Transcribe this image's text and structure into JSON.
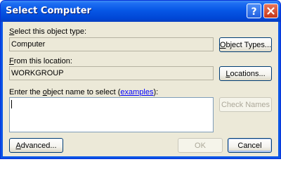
{
  "window": {
    "title": "Select Computer"
  },
  "object_type": {
    "label_prefix": "",
    "label_accel": "S",
    "label_rest": "elect this object type:",
    "value": "Computer",
    "button": {
      "accel": "O",
      "rest": "bject Types..."
    }
  },
  "location": {
    "label_accel": "F",
    "label_rest": "rom this location:",
    "value": "WORKGROUP",
    "button": {
      "accel": "L",
      "rest": "ocations..."
    }
  },
  "object_name": {
    "label_before": "Enter the ",
    "label_accel": "o",
    "label_middle": "bject name to select (",
    "link_text": "examples",
    "label_after": "):",
    "value": "",
    "check_button": "Check Names"
  },
  "footer": {
    "advanced": {
      "accel": "A",
      "rest": "dvanced..."
    },
    "ok": "OK",
    "cancel": "Cancel"
  },
  "icons": {
    "help": "question-mark-icon",
    "close": "close-icon"
  },
  "colors": {
    "titlebar": "#0757e6",
    "client": "#ece9d8",
    "close_button": "#c6371a",
    "link": "#0000ff"
  }
}
